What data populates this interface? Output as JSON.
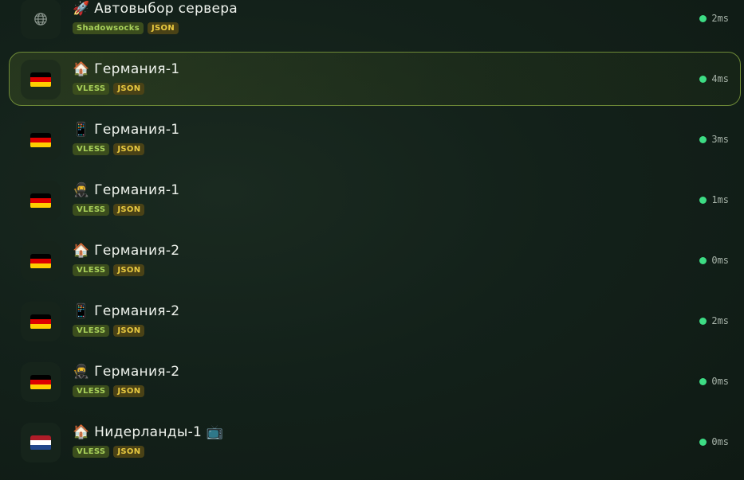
{
  "colors": {
    "accent_border": "#6e8a37",
    "ping_dot": "#3ddc84",
    "tag_protocol_bg": "#3b4d1d",
    "tag_protocol_fg": "#a8d15a",
    "tag_format_bg": "#4a4216",
    "tag_format_fg": "#e8c93f"
  },
  "servers": [
    {
      "icon": "globe-icon",
      "name": "🚀 Автовыбор сервера",
      "protocol": "Shadowsocks",
      "format": "JSON",
      "ping": "2ms",
      "selected": false
    },
    {
      "icon": "flag-de-icon",
      "name": "🏠 Германия-1",
      "protocol": "VLESS",
      "format": "JSON",
      "ping": "4ms",
      "selected": true
    },
    {
      "icon": "flag-de-icon",
      "name": "📱 Германия-1",
      "protocol": "VLESS",
      "format": "JSON",
      "ping": "3ms",
      "selected": false
    },
    {
      "icon": "flag-de-icon",
      "name": "🥷 Германия-1",
      "protocol": "VLESS",
      "format": "JSON",
      "ping": "1ms",
      "selected": false
    },
    {
      "icon": "flag-de-icon",
      "name": "🏠 Германия-2",
      "protocol": "VLESS",
      "format": "JSON",
      "ping": "0ms",
      "selected": false
    },
    {
      "icon": "flag-de-icon",
      "name": "📱 Германия-2",
      "protocol": "VLESS",
      "format": "JSON",
      "ping": "2ms",
      "selected": false
    },
    {
      "icon": "flag-de-icon",
      "name": "🥷 Германия-2",
      "protocol": "VLESS",
      "format": "JSON",
      "ping": "0ms",
      "selected": false
    },
    {
      "icon": "flag-nl-icon",
      "name": "🏠 Нидерланды-1 📺",
      "protocol": "VLESS",
      "format": "JSON",
      "ping": "0ms",
      "selected": false
    }
  ]
}
